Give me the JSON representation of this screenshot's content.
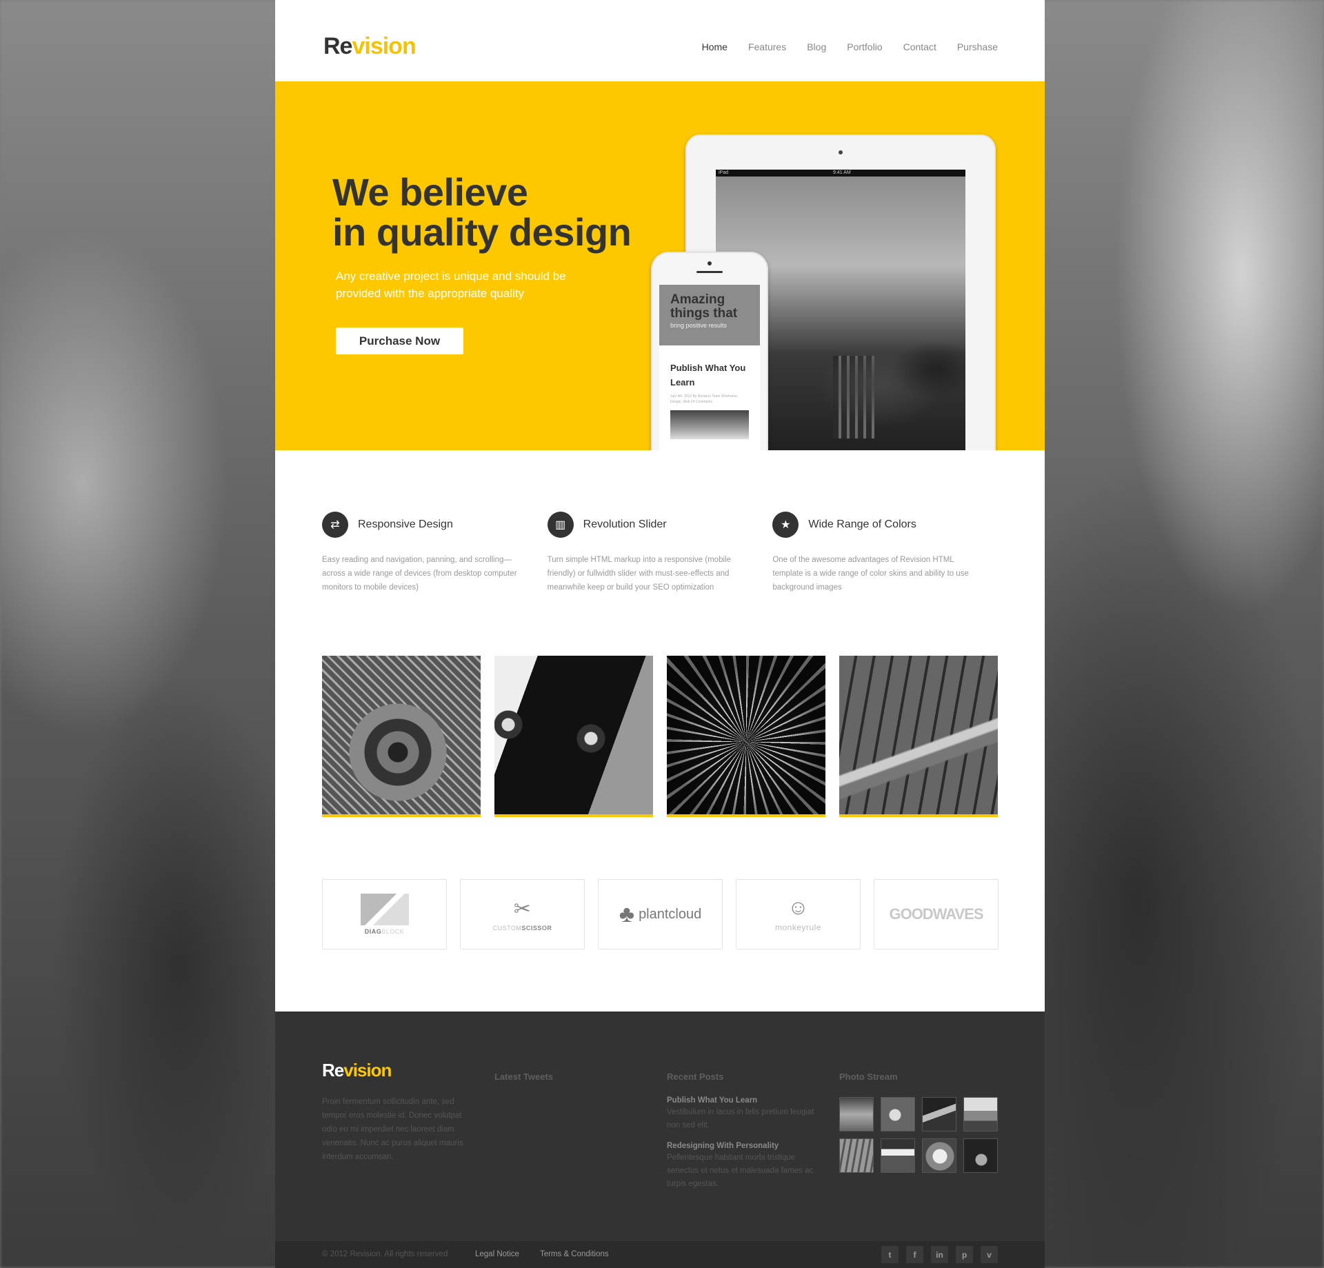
{
  "brand": {
    "re": "Re",
    "vision": "vision"
  },
  "nav": {
    "items": [
      "Home",
      "Features",
      "Blog",
      "Portfolio",
      "Contact",
      "Purshase"
    ],
    "active": "Home"
  },
  "hero": {
    "title_line1": "We believe",
    "title_line2": "in quality design",
    "subtitle": "Any creative project is unique and should be provided with the appropriate quality",
    "cta": "Purchase Now",
    "tablet_status_left": "iPad",
    "tablet_status_time": "9:41 AM",
    "phone_banner_title": "Amazing things that",
    "phone_banner_sub": "bring positive results",
    "phone_post_title": "Publish What You Learn",
    "phone_post_meta": "July 4th, 2012  By Revision Team  Wireframe, Design, Web  24 Comments"
  },
  "features": [
    {
      "icon": "arrows-exchange-icon",
      "glyph": "⇄",
      "title": "Responsive Design",
      "text": "Easy reading and navigation, panning, and scrolling—across a wide range of devices (from desktop computer monitors to mobile devices)"
    },
    {
      "icon": "slider-icon",
      "glyph": "▥",
      "title": "Revolution Slider",
      "text": "Turn simple HTML markup into a responsive (mobile friendly) or fullwidth slider with must-see-effects and meanwhile keep or build your SEO optimization"
    },
    {
      "icon": "star-icon",
      "glyph": "★",
      "title": "Wide Range of Colors",
      "text": "One of the awesome advantages of Revision HTML template is a wide range of color skins and ability to use background images"
    }
  ],
  "clients": {
    "diagblock_a": "DIAG",
    "diagblock_b": "BLOCK",
    "customscissor_a": "CUSTOM",
    "customscissor_b": "SCISSOR",
    "plantcloud": "plantcloud",
    "monkeyrule": "monkeyrule",
    "goodwaves": "GOODWAVES"
  },
  "footer": {
    "about": "Proin fermentum sollicitudin ante, sed tempor eros molestie id. Donec volutpat odio eu mi imperdiet nec laoreet diam venenatis. Nunc ac purus aliquet mauris interdum accumsan.",
    "tweets_title": "Latest Tweets",
    "posts_title": "Recent Posts",
    "stream_title": "Photo Stream",
    "posts": [
      {
        "title": "Publish What You Learn",
        "excerpt": "Vestibulum in lacus in felis pretium feugiat non sed elit."
      },
      {
        "title": "Redesigning With Personality",
        "excerpt": "Pellentesque habitant morbi tristique senectus et netus et malesuada fames ac turpis egestas."
      }
    ],
    "copyright": "© 2012 Revision. All rights reserved",
    "legal": "Legal Notice",
    "terms": "Terms & Conditions"
  },
  "social": [
    {
      "name": "twitter-icon",
      "glyph": "t"
    },
    {
      "name": "facebook-icon",
      "glyph": "f"
    },
    {
      "name": "linkedin-icon",
      "glyph": "in"
    },
    {
      "name": "pinterest-icon",
      "glyph": "p"
    },
    {
      "name": "vimeo-icon",
      "glyph": "v"
    }
  ],
  "colors": {
    "accent": "#fdc800",
    "dark": "#333333",
    "footer": "#333333"
  }
}
